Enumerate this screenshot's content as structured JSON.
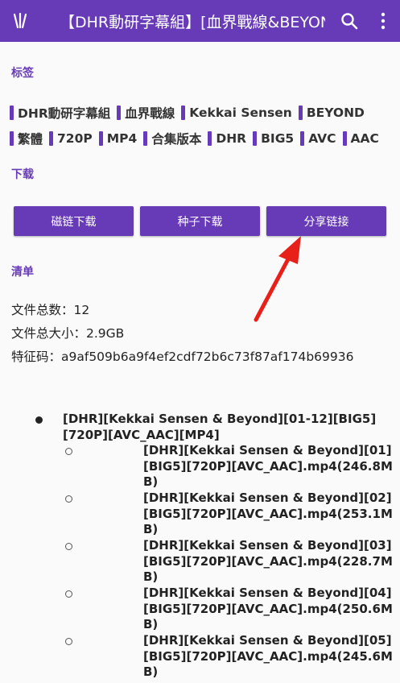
{
  "appbar": {
    "title": "【DHR動研字幕組】[血界戰線&BEYOND]...",
    "logo_icon": "app-logo-icon",
    "search_icon": "search-icon",
    "more_icon": "more-vert-icon"
  },
  "sections": {
    "tags": "标签",
    "download": "下载",
    "list": "清单"
  },
  "tags": {
    "row1": [
      "DHR動研字幕組",
      "血界戰線",
      "Kekkai Sensen",
      "BEYOND"
    ],
    "row2": [
      "繁體",
      "720P",
      "MP4",
      "合集版本",
      "DHR",
      "BIG5",
      "AVC",
      "AAC"
    ]
  },
  "buttons": {
    "magnet": "磁链下载",
    "torrent": "种子下载",
    "share": "分享链接"
  },
  "info": {
    "file_count": "文件总数：12",
    "total_size": "文件总大小：2.9GB",
    "hash": "特征码：a9af509b6a9f4ef2cdf72b6c73f87af174b69936"
  },
  "tree": {
    "root": "[DHR][Kekkai Sensen & Beyond][01-12][BIG5][720P][AVC_AAC][MP4]",
    "children": [
      "[DHR][Kekkai Sensen & Beyond][01][BIG5][720P][AVC_AAC].mp4(246.8MB)",
      "[DHR][Kekkai Sensen & Beyond][02][BIG5][720P][AVC_AAC].mp4(253.1MB)",
      "[DHR][Kekkai Sensen & Beyond][03][BIG5][720P][AVC_AAC].mp4(228.7MB)",
      "[DHR][Kekkai Sensen & Beyond][04][BIG5][720P][AVC_AAC].mp4(250.6MB)",
      "[DHR][Kekkai Sensen & Beyond][05][BIG5][720P][AVC_AAC].mp4(245.6MB)"
    ]
  },
  "colors": {
    "primary": "#673ab7",
    "annotation_arrow": "#e8201a"
  }
}
